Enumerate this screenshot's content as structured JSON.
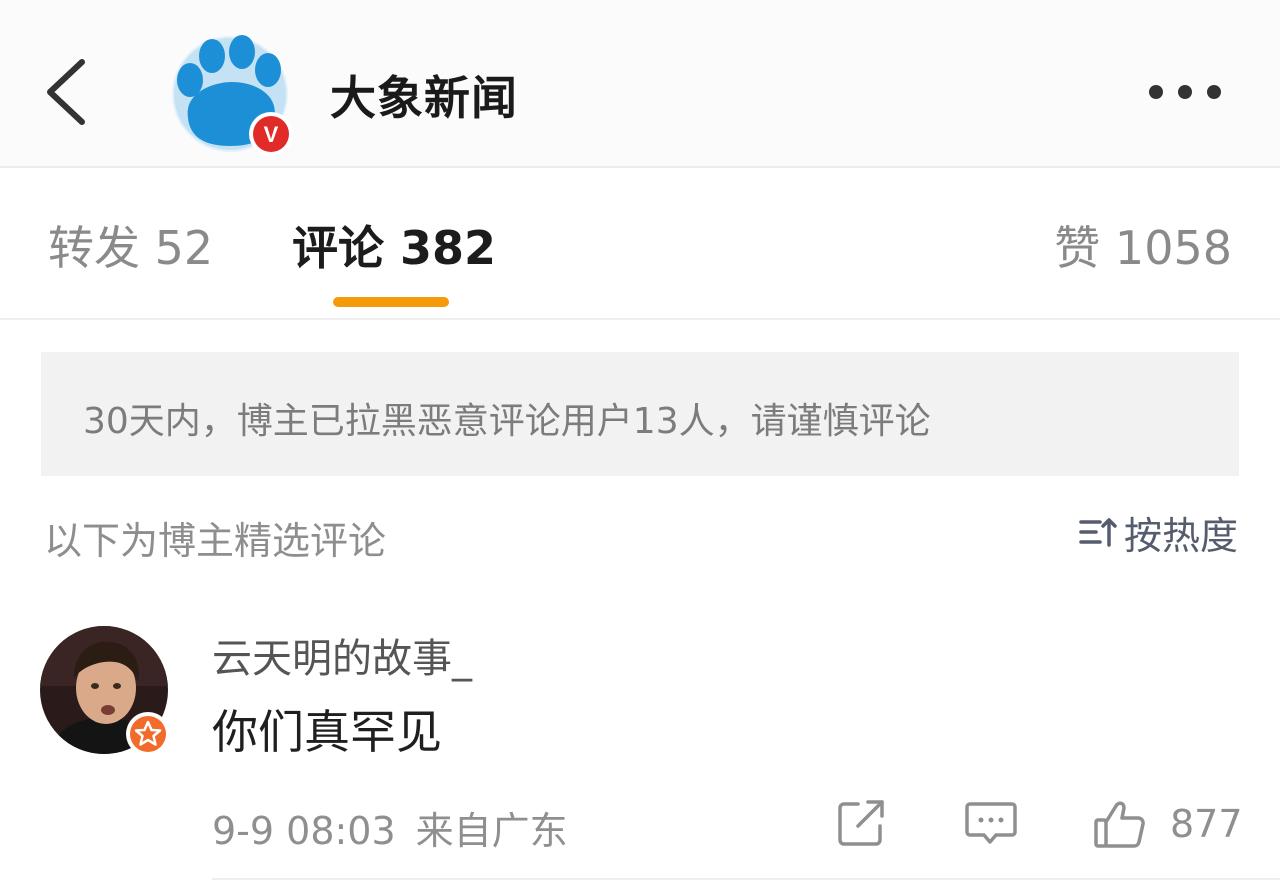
{
  "header": {
    "account_name": "大象新闻",
    "back_icon": "back-chevron-icon",
    "more_icon": "more-dots-icon",
    "verified_badge": "V"
  },
  "tabs": [
    {
      "label": "转发",
      "count": "52"
    },
    {
      "label": "评论",
      "count": "382",
      "active": true
    },
    {
      "label": "赞",
      "count": "1058"
    }
  ],
  "notice": {
    "text": "30天内，博主已拉黑恶意评论用户13人，请谨慎评论"
  },
  "section": {
    "title": "以下为博主精选评论",
    "sort_label": "按热度"
  },
  "comment": {
    "username": "云天明的故事_",
    "text": "你们真罕见",
    "time": "9-9 08:03",
    "location": "来自广东",
    "like_count": "877"
  },
  "colors": {
    "accent": "#f59a0b",
    "verified_red": "#e02b28",
    "avatar_blue": "#1d8fd6",
    "user_badge": "#f26b2b"
  }
}
